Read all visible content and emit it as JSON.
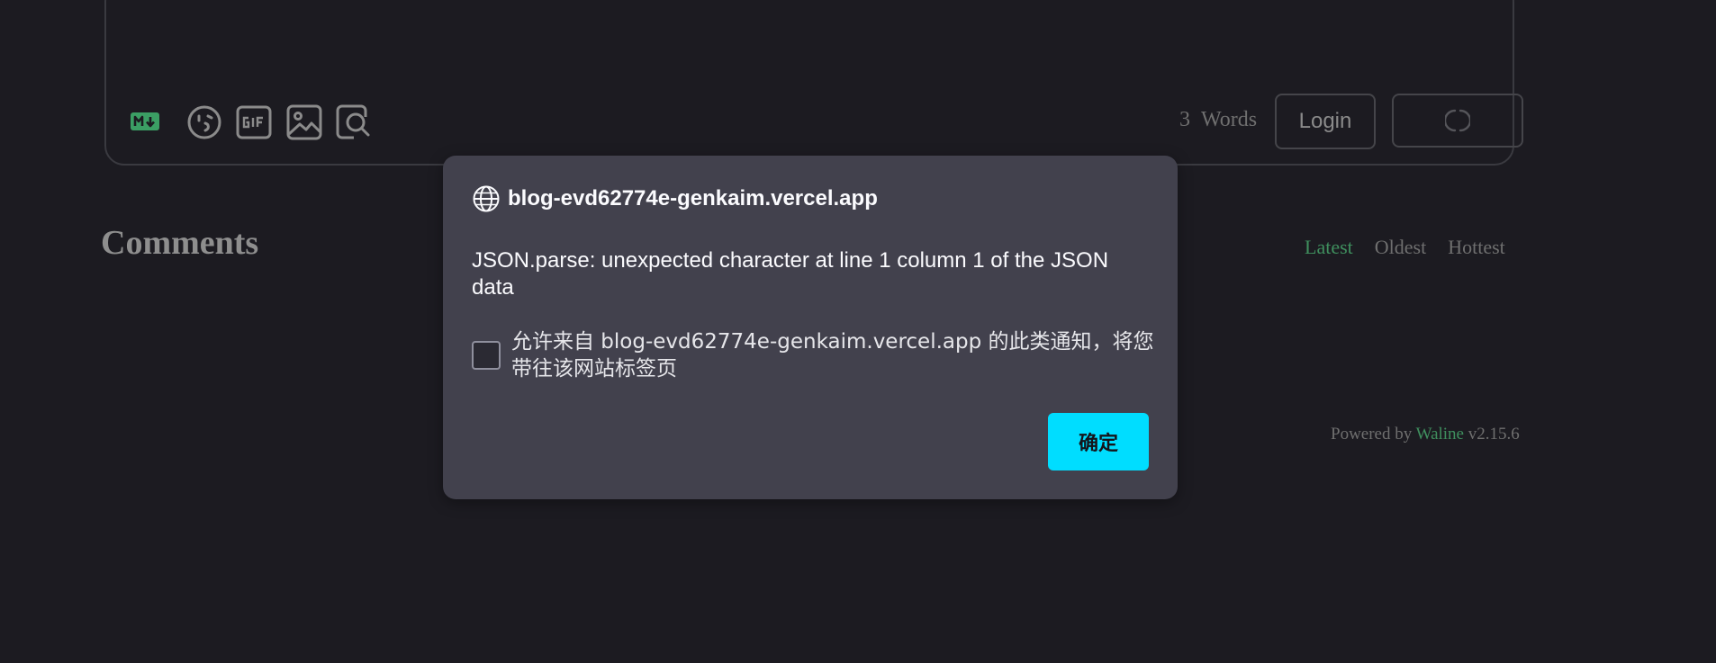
{
  "editor": {
    "toolbar": [
      {
        "icon": "markdown-icon"
      },
      {
        "icon": "emoji-icon"
      },
      {
        "icon": "gif-icon"
      },
      {
        "icon": "image-icon"
      },
      {
        "icon": "preview-icon"
      }
    ],
    "word_count": {
      "value": "3",
      "label": "Words"
    },
    "login_label": "Login",
    "submit_icon": "spinner-icon"
  },
  "comments": {
    "title": "Comments",
    "sort_tabs": [
      {
        "label": "Latest",
        "active": true
      },
      {
        "label": "Oldest",
        "active": false
      },
      {
        "label": "Hottest",
        "active": false
      }
    ],
    "powered_prefix": "Powered by",
    "powered_link": "Waline",
    "powered_version": "v2.15.6"
  },
  "dialog": {
    "icon": "globe-icon",
    "origin": "blog-evd62774e-genkaim.vercel.app",
    "message": "JSON.parse: unexpected character at line 1 column 1 of the JSON data",
    "checkbox_label": "允许来自 blog-evd62774e-genkaim.vercel.app 的此类通知，将您带往该网站标签页",
    "checkbox_checked": false,
    "ok_label": "确定"
  },
  "colors": {
    "background": "#1c1b21",
    "accent_green": "#3f8f5e",
    "dialog_bg": "#42414d",
    "ok_button": "#00ddff"
  }
}
